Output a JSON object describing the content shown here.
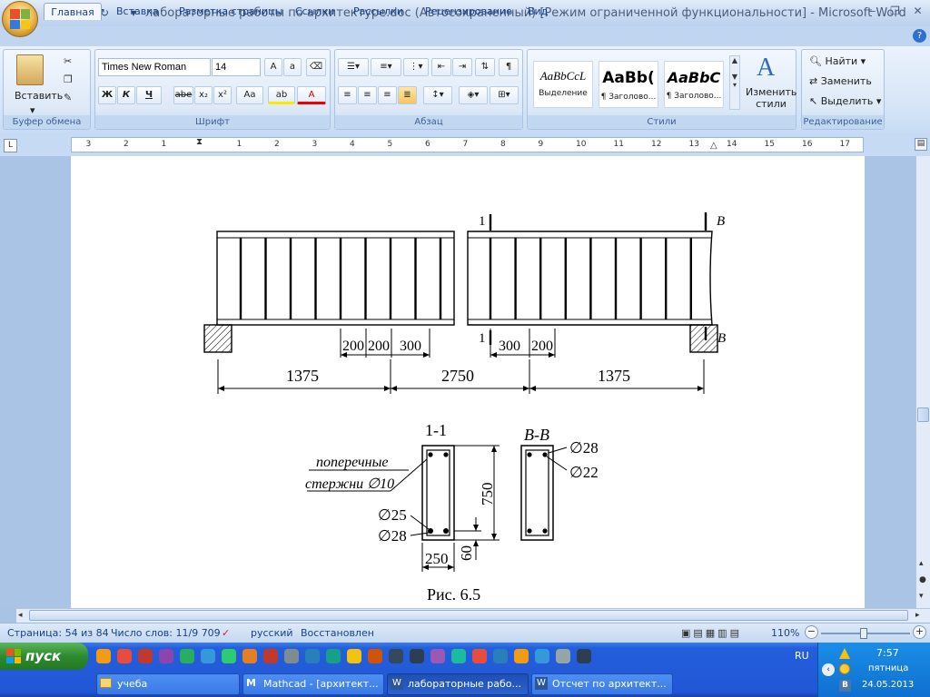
{
  "titlebar": {
    "title": "лабораторные работы по архитектуре.doc (Автосохраненный) [Режим ограниченной функциональности] - Microsoft Word",
    "undo_icon": "undo-icon",
    "redo_icon": "redo-icon"
  },
  "tabs": [
    "Главная",
    "Вставка",
    "Разметка страницы",
    "Ссылки",
    "Рассылки",
    "Рецензирование",
    "Вид"
  ],
  "ribbon": {
    "clipboard": {
      "label": "Буфер обмена",
      "paste": "Вставить"
    },
    "font": {
      "label": "Шрифт",
      "family": "Times New Roman",
      "size": "14",
      "bold": "Ж",
      "italic": "К",
      "underline": "Ч",
      "strike": "abe",
      "sub": "x₂",
      "sup": "x²",
      "case": "Aa"
    },
    "paragraph": {
      "label": "Абзац"
    },
    "styles": {
      "label": "Стили",
      "items": [
        {
          "sample": "AaBbCcL",
          "name": "Выделение"
        },
        {
          "sample": "AaBb(",
          "name": "¶ Заголово..."
        },
        {
          "sample": "AaBbC",
          "name": "¶ Заголово..."
        }
      ],
      "change": "Изменить стили"
    },
    "editing": {
      "label": "Редактирование",
      "find": "Найти",
      "replace": "Заменить",
      "select": "Выделить"
    }
  },
  "ruler": {
    "numbers": [
      "3",
      "2",
      "1",
      "1",
      "2",
      "3",
      "4",
      "5",
      "6",
      "7",
      "8",
      "9",
      "10",
      "11",
      "12",
      "13",
      "14",
      "15",
      "16",
      "17"
    ]
  },
  "drawing": {
    "section1": "1",
    "sectionB": "B",
    "dims_small": [
      "200",
      "200",
      "300",
      "300",
      "200"
    ],
    "dims_big": [
      "1375",
      "2750",
      "1375"
    ],
    "cs1_title": "1-1",
    "cs2_title": "B-B",
    "label_transverse_1": "поперечные",
    "label_transverse_2": "стержни ∅10",
    "label_d25": "∅25",
    "label_d28_bottom": "∅28",
    "label_750": "750",
    "label_60": "60",
    "label_250": "250",
    "label_d28_top": "∅28",
    "label_d22": "∅22",
    "caption": "Рис. 6.5"
  },
  "statusbar": {
    "page": "Страница: 54 из 84",
    "words": "Число слов: 11/9 709",
    "language": "русский",
    "state": "Восстановлен",
    "zoom": "110%"
  },
  "taskbar": {
    "start": "пуск",
    "windows": [
      "учеба",
      "Mathcad - [архитект...",
      "лабораторные рабо...",
      "Отсчет по архитект..."
    ],
    "lang": "RU",
    "time": "7:57",
    "day": "пятница",
    "date": "24.05.2013"
  },
  "colors": {
    "accent": "#15428b",
    "ribbon": "#dde9f7",
    "taskbar": "#245edb",
    "start": "#2e8b2e"
  }
}
